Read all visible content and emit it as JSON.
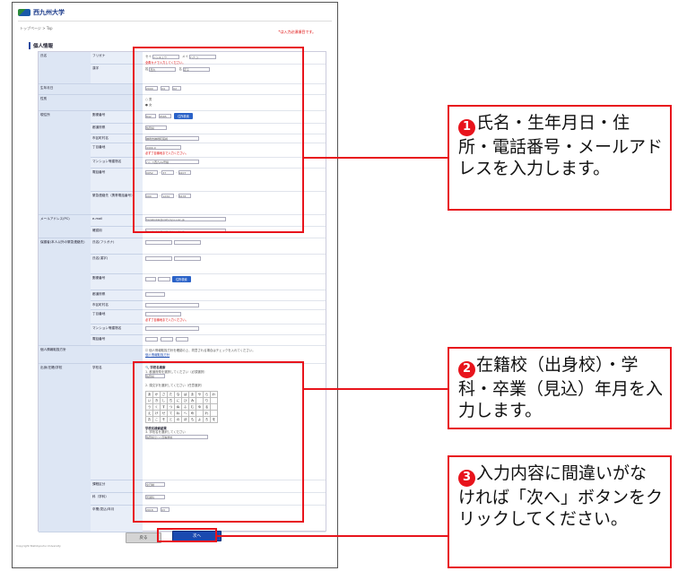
{
  "site": {
    "logo_text": "西九州大学",
    "breadcrumb": "トップページ > Top",
    "required_note": "*は入力必須項目です。",
    "section_title": "個人情報"
  },
  "form": {
    "name": {
      "label": "氏名",
      "kana_label": "フリガナ",
      "kana_sei": "セイ",
      "kana_sei_value": "ニシキュウ",
      "kana_mei": "メイ",
      "kana_mei_value": "ハナコ",
      "kana_note": "全角カナで入力してください。",
      "kanji_label": "漢字",
      "kanji_sei": "姓",
      "kanji_sei_value": "西九",
      "kanji_mei": "名",
      "kanji_mei_value": "花子"
    },
    "birth": {
      "label": "生年月日",
      "year": "2000",
      "month": "04",
      "day": "02"
    },
    "gender": {
      "label": "性別",
      "opt1": "男",
      "opt2": "女"
    },
    "address": {
      "label": "現住所",
      "zip_label": "郵便番号",
      "zip1": "842",
      "zip2": "8585",
      "zip_button": "住所検索",
      "pref_label": "都道府県",
      "pref_value": "佐賀県",
      "city_label": "市区町村名",
      "city_value": "神埼市神埼町尾崎",
      "street_label": "丁目番地",
      "street_value": "4490-9",
      "street_note": "必ず丁目番地まで入力ください。",
      "bldg_label": "マンション等建物名",
      "bldg_value": "ハレス西九2A号棟",
      "phone_label": "電話番号",
      "phone1": "0952",
      "phone2": "37",
      "phone3": "9207",
      "mobile_label": "緊急連絡先（携帯電話番号）",
      "mobile1": "090",
      "mobile2": "1234",
      "mobile3": "5678"
    },
    "email": {
      "label": "メールアドレス(PC)",
      "email_label": "e-mail",
      "email_value": "hanakokei@nishi.kyu-u.ac.jp",
      "confirm_label": "確認用",
      "confirm_value": "hanakokei@nishi.kyu-u.ac.jp"
    },
    "guardian": {
      "label": "保護者(本人以外の緊急連絡先)",
      "kana_label": "氏名(フリガナ)",
      "kanji_label": "氏名(漢字)",
      "zip_label": "郵便番号",
      "pref_label": "都道府県",
      "city_label": "市区町村名",
      "street_label": "丁目番地",
      "bldg_label": "マンション等建物名",
      "phone_label": "電話番号",
      "zip_button": "住所検索"
    },
    "privacy": {
      "label": "個人情報取扱方針",
      "text": "個人情報取扱方針を確認の上、同意される場合はチェックを入れてください。",
      "link": "個人情報取扱方針"
    },
    "school": {
      "label": "出身(在籍)学校",
      "name_label": "学校名",
      "search_title": "学校名検索",
      "step1": "1. 都道府県を選択してください（必須選択）",
      "pref_value": "佐賀県",
      "step2": "2. 頭文字を選択してください（任意選択）",
      "kana": [
        "あ",
        "か",
        "さ",
        "た",
        "な",
        "は",
        "ま",
        "や",
        "ら",
        "わ",
        "い",
        "き",
        "し",
        "ち",
        "に",
        "ひ",
        "み",
        "",
        "り",
        "",
        "う",
        "く",
        "す",
        "つ",
        "ぬ",
        "ふ",
        "む",
        "ゆ",
        "る",
        "",
        "え",
        "け",
        "せ",
        "て",
        "ね",
        "へ",
        "め",
        "",
        "れ",
        "",
        "お",
        "こ",
        "そ",
        "と",
        "の",
        "ほ",
        "も",
        "よ",
        "ろ",
        "を"
      ],
      "result_title": "学校名検索結果",
      "step3": "3. 学校名を選択してください",
      "school_value": "佐賀県立○○高等学校",
      "course_label": "課程区分",
      "course_value": "全日制",
      "dept_label": "科（学科）",
      "dept_value": "普通科",
      "grad_label": "卒業(見込)年月",
      "grad_year": "2018",
      "grad_month": "03"
    }
  },
  "buttons": {
    "back": "戻る",
    "next": "次へ"
  },
  "footer": "Copyright Nishikyushu University",
  "callouts": [
    {
      "num": "1",
      "text": "氏名・生年月日・住所・電話番号・メールアドレスを入力します。"
    },
    {
      "num": "2",
      "text": "在籍校（出身校）・学科・卒業（見込）年月を入力します。"
    },
    {
      "num": "3",
      "text": "入力内容に間違いがなければ「次へ」ボタンをクリックしてください。"
    }
  ],
  "colors": {
    "highlight": "#e8141c",
    "label_bg": "#dde6f4",
    "next_button": "#1a4ab0"
  }
}
